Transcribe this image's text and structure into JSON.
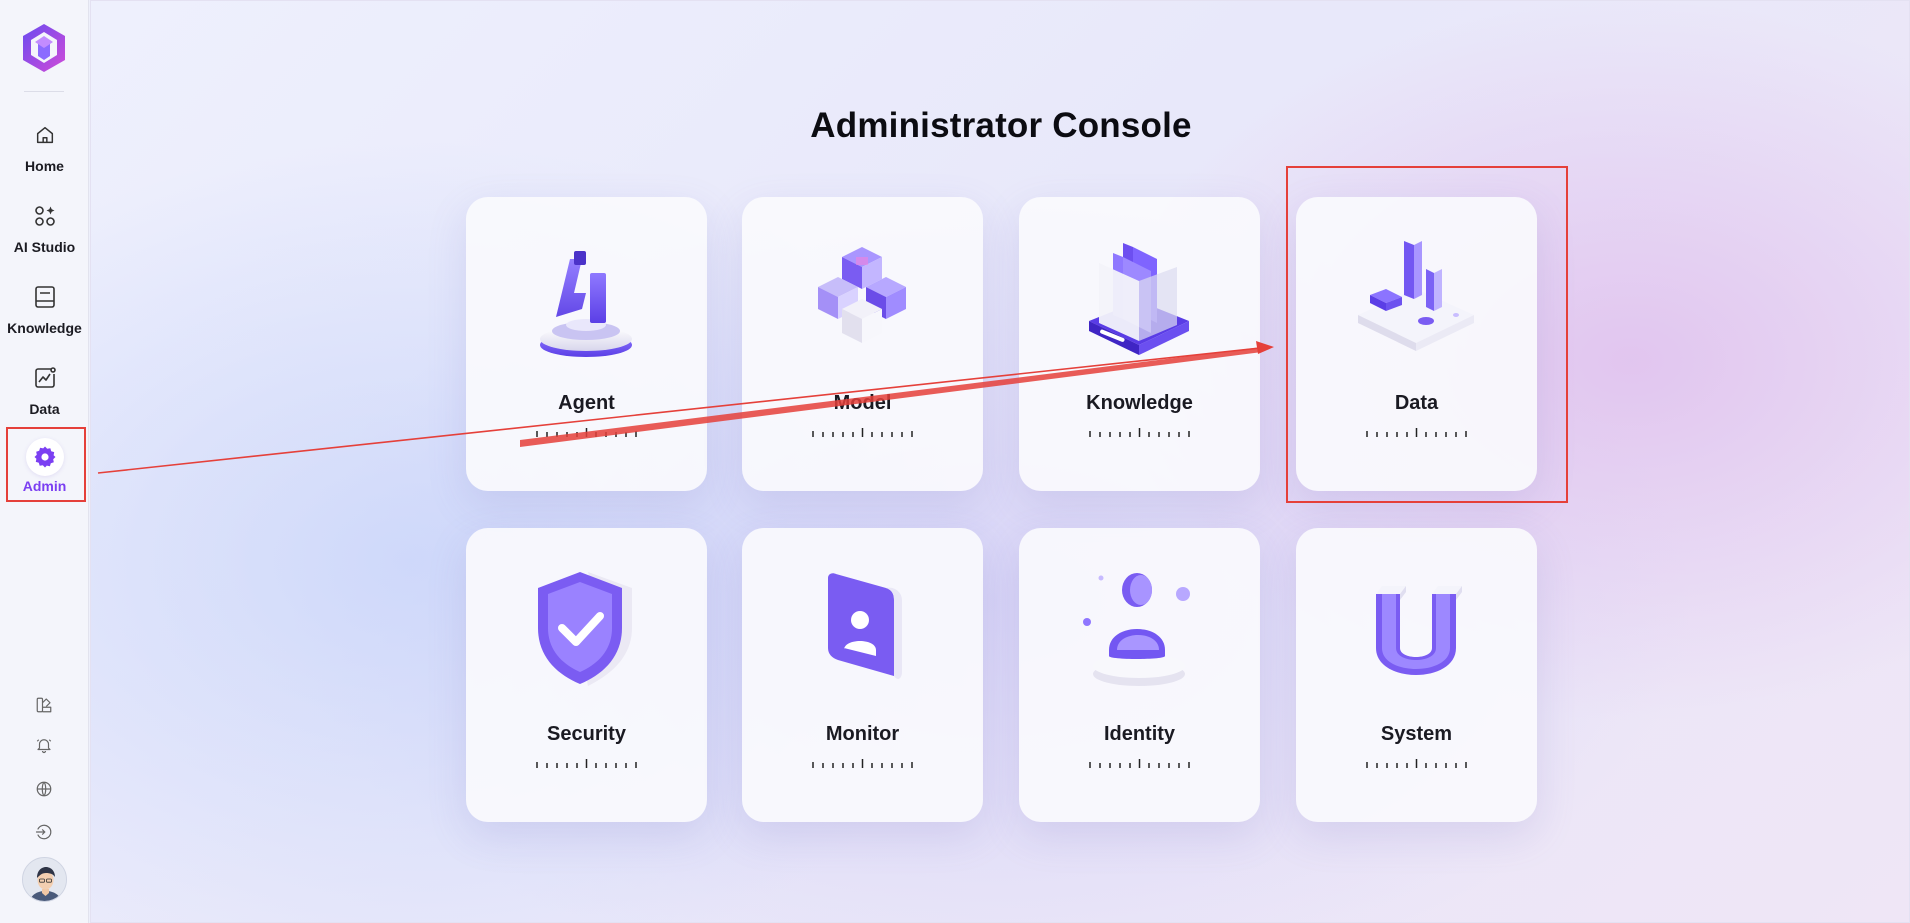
{
  "sidebar": {
    "nav": [
      {
        "label": "Home",
        "icon": "home-icon"
      },
      {
        "label": "AI Studio",
        "icon": "ai-studio-icon"
      },
      {
        "label": "Knowledge",
        "icon": "book-icon"
      },
      {
        "label": "Data",
        "icon": "chart-icon"
      },
      {
        "label": "Admin",
        "icon": "gear-icon",
        "active": true
      }
    ],
    "utilities": [
      "palette-icon",
      "bell-icon",
      "globe-icon",
      "logout-icon"
    ],
    "active_color": "#7b3ff2"
  },
  "main": {
    "title": "Administrator Console",
    "cards": [
      {
        "label": "Agent"
      },
      {
        "label": "Model"
      },
      {
        "label": "Knowledge"
      },
      {
        "label": "Data"
      },
      {
        "label": "Security"
      },
      {
        "label": "Monitor"
      },
      {
        "label": "Identity"
      },
      {
        "label": "System"
      }
    ]
  },
  "annotation_color": "#e5403a"
}
